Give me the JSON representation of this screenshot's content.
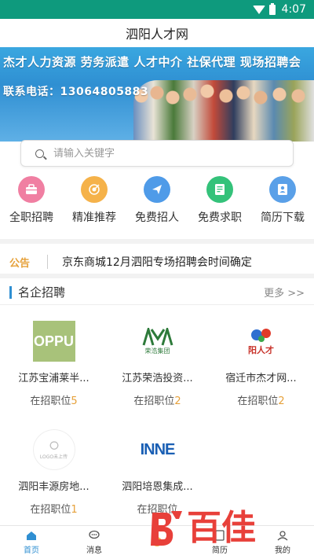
{
  "status": {
    "time": "4:07"
  },
  "header": {
    "title": "泗阳人才网"
  },
  "banner": {
    "services": "杰才人力资源  劳务派遣  人才中介  社保代理  现场招聘会",
    "phone": "联系电话：13064805883"
  },
  "search": {
    "placeholder": "请输入关键字"
  },
  "quick_links": [
    {
      "label": "全职招聘",
      "icon": "briefcase-icon",
      "color": "#f07fa2"
    },
    {
      "label": "精准推荐",
      "icon": "target-icon",
      "color": "#f5b24a"
    },
    {
      "label": "免费招人",
      "icon": "send-icon",
      "color": "#4f9be8"
    },
    {
      "label": "免费求职",
      "icon": "resume-icon",
      "color": "#34c27a"
    },
    {
      "label": "简历下载",
      "icon": "profile-icon",
      "color": "#5aa0e8"
    }
  ],
  "notice": {
    "tag": "公告",
    "text": "京东商城12月泗阳专场招聘会时间确定"
  },
  "companies_section": {
    "title": "名企招聘",
    "more": "更多 >>"
  },
  "companies": [
    {
      "name": "江苏宝浦莱半...",
      "jobs_label": "在招职位",
      "jobs": "5",
      "logo": "OPPU"
    },
    {
      "name": "江苏荣浩投资...",
      "jobs_label": "在招职位",
      "jobs": "2",
      "logo": "荣浩集团"
    },
    {
      "name": "宿迁市杰才网...",
      "jobs_label": "在招职位",
      "jobs": "2",
      "logo": "阳人才"
    },
    {
      "name": "泗阳丰源房地...",
      "jobs_label": "在招职位",
      "jobs": "1",
      "logo": "LOGO未上传"
    },
    {
      "name": "泗阳培恩集成...",
      "jobs_label": "在招职位",
      "jobs": "",
      "logo": "INNE"
    }
  ],
  "tabbar": [
    {
      "label": "首页",
      "icon": "home-icon",
      "active": true
    },
    {
      "label": "消息",
      "icon": "message-icon"
    },
    {
      "label": "",
      "icon": "publish-icon"
    },
    {
      "label": "简历",
      "icon": "resume-tab-icon"
    },
    {
      "label": "我的",
      "icon": "user-icon"
    }
  ],
  "watermark": {
    "text": "百佳"
  },
  "colors": {
    "accent": "#2f8fd2",
    "statusbar": "#0e9a7d",
    "highlight": "#e6a13a"
  }
}
